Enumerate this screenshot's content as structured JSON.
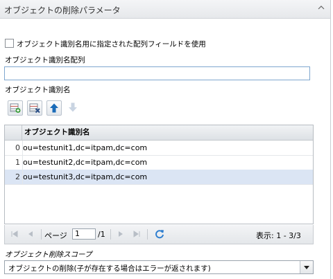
{
  "panel": {
    "title": "オブジェクトの削除パラメータ"
  },
  "options": {
    "use_array_field_label": "オブジェクト識別名用に指定された配列フィールドを使用",
    "use_array_field_checked": false
  },
  "array_field": {
    "label": "オブジェクト識別名配列",
    "value": ""
  },
  "dn_section": {
    "label": "オブジェクト識別名"
  },
  "toolbar": {
    "icons": [
      "add-row-icon",
      "delete-row-icon",
      "move-up-icon",
      "move-down-icon"
    ]
  },
  "grid": {
    "column_header": "オブジェクト識別名",
    "rows": [
      {
        "index": "0",
        "value": "ou=testunit1,dc=itpam,dc=com"
      },
      {
        "index": "1",
        "value": "ou=testunit2,dc=itpam,dc=com"
      },
      {
        "index": "2",
        "value": "ou=testunit3,dc=itpam,dc=com"
      }
    ],
    "selected_row": 2
  },
  "pager": {
    "page_label": "ページ",
    "current_page": "1",
    "total_pages": "/1",
    "display_text": "表示: 1 - 3/3"
  },
  "scope": {
    "label": "オブジェクト削除スコープ",
    "selected": "オブジェクトの削除(子が存在する場合はエラーが返されます)"
  },
  "colors": {
    "accent": "#1a6bb8",
    "selected_row": "#dbe5f4",
    "input_border": "#7ea6cf"
  }
}
